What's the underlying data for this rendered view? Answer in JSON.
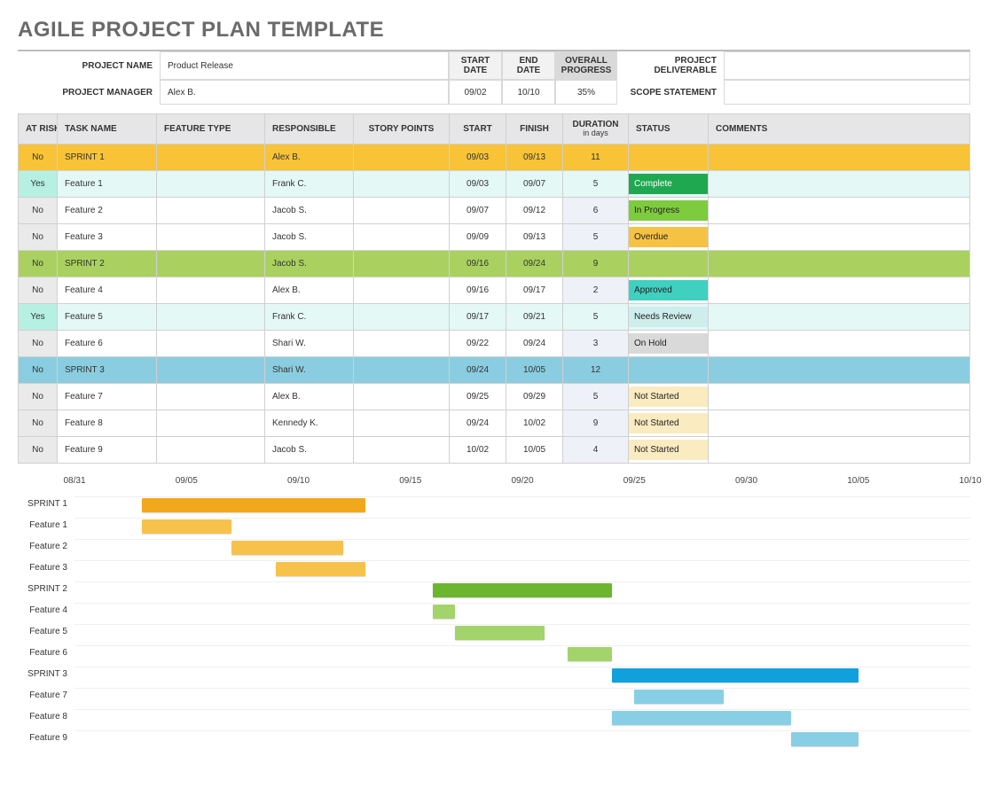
{
  "title": "AGILE PROJECT PLAN TEMPLATE",
  "header": {
    "labels": {
      "project_name": "PROJECT NAME",
      "project_manager": "PROJECT MANAGER",
      "start_date": "START DATE",
      "end_date": "END DATE",
      "overall_progress": "OVERALL PROGRESS",
      "project_deliverable": "PROJECT DELIVERABLE",
      "scope_statement": "SCOPE STATEMENT"
    },
    "values": {
      "project_name": "Product Release",
      "project_manager": "Alex B.",
      "start_date": "09/02",
      "end_date": "10/10",
      "overall_progress": "35%",
      "project_deliverable": "",
      "scope_statement": ""
    }
  },
  "table": {
    "headers": {
      "at_risk": "AT RISK",
      "task_name": "TASK NAME",
      "feature_type": "FEATURE TYPE",
      "responsible": "RESPONSIBLE",
      "story_points": "STORY POINTS",
      "start": "START",
      "finish": "FINISH",
      "duration": "DURATION",
      "duration_sub": "in days",
      "status": "STATUS",
      "comments": "COMMENTS"
    },
    "rows": [
      {
        "at_risk": "No",
        "task": "SPRINT 1",
        "feature": "",
        "resp": "Alex B.",
        "story": "",
        "start": "09/03",
        "finish": "09/13",
        "dur": "11",
        "status": "",
        "comments": "",
        "type": "sprint",
        "sprint": 1
      },
      {
        "at_risk": "Yes",
        "task": "Feature 1",
        "feature": "",
        "resp": "Frank C.",
        "story": "",
        "start": "09/03",
        "finish": "09/07",
        "dur": "5",
        "status": "Complete",
        "status_key": "complete",
        "comments": "",
        "type": "feature"
      },
      {
        "at_risk": "No",
        "task": "Feature 2",
        "feature": "",
        "resp": "Jacob S.",
        "story": "",
        "start": "09/07",
        "finish": "09/12",
        "dur": "6",
        "status": "In Progress",
        "status_key": "inprogress",
        "comments": "",
        "type": "feature"
      },
      {
        "at_risk": "No",
        "task": "Feature 3",
        "feature": "",
        "resp": "Jacob S.",
        "story": "",
        "start": "09/09",
        "finish": "09/13",
        "dur": "5",
        "status": "Overdue",
        "status_key": "overdue",
        "comments": "",
        "type": "feature"
      },
      {
        "at_risk": "No",
        "task": "SPRINT 2",
        "feature": "",
        "resp": "Jacob S.",
        "story": "",
        "start": "09/16",
        "finish": "09/24",
        "dur": "9",
        "status": "",
        "comments": "",
        "type": "sprint",
        "sprint": 2
      },
      {
        "at_risk": "No",
        "task": "Feature 4",
        "feature": "",
        "resp": "Alex B.",
        "story": "",
        "start": "09/16",
        "finish": "09/17",
        "dur": "2",
        "status": "Approved",
        "status_key": "approved",
        "comments": "",
        "type": "feature"
      },
      {
        "at_risk": "Yes",
        "task": "Feature 5",
        "feature": "",
        "resp": "Frank C.",
        "story": "",
        "start": "09/17",
        "finish": "09/21",
        "dur": "5",
        "status": "Needs Review",
        "status_key": "needsreview",
        "comments": "",
        "type": "feature"
      },
      {
        "at_risk": "No",
        "task": "Feature 6",
        "feature": "",
        "resp": "Shari W.",
        "story": "",
        "start": "09/22",
        "finish": "09/24",
        "dur": "3",
        "status": "On Hold",
        "status_key": "onhold",
        "comments": "",
        "type": "feature"
      },
      {
        "at_risk": "No",
        "task": "SPRINT 3",
        "feature": "",
        "resp": "Shari W.",
        "story": "",
        "start": "09/24",
        "finish": "10/05",
        "dur": "12",
        "status": "",
        "comments": "",
        "type": "sprint",
        "sprint": 3
      },
      {
        "at_risk": "No",
        "task": "Feature 7",
        "feature": "",
        "resp": "Alex B.",
        "story": "",
        "start": "09/25",
        "finish": "09/29",
        "dur": "5",
        "status": "Not Started",
        "status_key": "notstarted",
        "comments": "",
        "type": "feature"
      },
      {
        "at_risk": "No",
        "task": "Feature 8",
        "feature": "",
        "resp": "Kennedy K.",
        "story": "",
        "start": "09/24",
        "finish": "10/02",
        "dur": "9",
        "status": "Not Started",
        "status_key": "notstarted",
        "comments": "",
        "type": "feature"
      },
      {
        "at_risk": "No",
        "task": "Feature 9",
        "feature": "",
        "resp": "Jacob S.",
        "story": "",
        "start": "10/02",
        "finish": "10/05",
        "dur": "4",
        "status": "Not Started",
        "status_key": "notstarted",
        "comments": "",
        "type": "feature"
      }
    ]
  },
  "chart_data": {
    "type": "bar",
    "title": "",
    "xlabel": "",
    "ylabel": "",
    "x_axis_ticks": [
      "08/31",
      "09/05",
      "09/10",
      "09/15",
      "09/20",
      "09/25",
      "09/30",
      "10/05",
      "10/10"
    ],
    "x_range_start": "08/31",
    "x_range_end": "10/10",
    "series": [
      {
        "name": "SPRINT 1",
        "start": "09/03",
        "end": "09/13",
        "color": "orange1"
      },
      {
        "name": "Feature 1",
        "start": "09/03",
        "end": "09/07",
        "color": "orange2"
      },
      {
        "name": "Feature 2",
        "start": "09/07",
        "end": "09/12",
        "color": "orange2"
      },
      {
        "name": "Feature 3",
        "start": "09/09",
        "end": "09/13",
        "color": "orange3"
      },
      {
        "name": "SPRINT 2",
        "start": "09/16",
        "end": "09/24",
        "color": "green1"
      },
      {
        "name": "Feature 4",
        "start": "09/16",
        "end": "09/17",
        "color": "green2"
      },
      {
        "name": "Feature 5",
        "start": "09/17",
        "end": "09/21",
        "color": "green2"
      },
      {
        "name": "Feature 6",
        "start": "09/22",
        "end": "09/24",
        "color": "green2"
      },
      {
        "name": "SPRINT 3",
        "start": "09/24",
        "end": "10/05",
        "color": "blue1"
      },
      {
        "name": "Feature 7",
        "start": "09/25",
        "end": "09/29",
        "color": "blue2"
      },
      {
        "name": "Feature 8",
        "start": "09/24",
        "end": "10/02",
        "color": "blue2"
      },
      {
        "name": "Feature 9",
        "start": "10/02",
        "end": "10/05",
        "color": "blue2"
      }
    ]
  }
}
